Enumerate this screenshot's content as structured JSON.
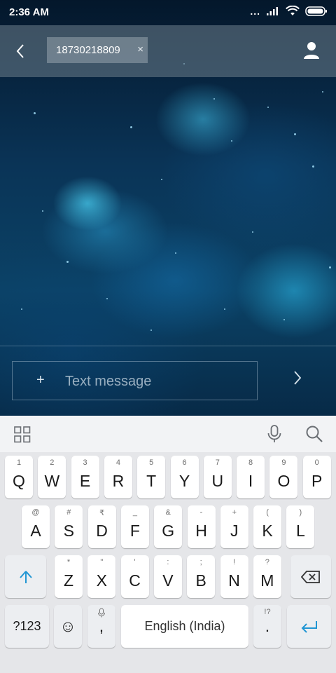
{
  "status_bar": {
    "time": "2:36 AM",
    "dots": "...",
    "icons": [
      "signal-icon",
      "wifi-icon",
      "battery-icon"
    ]
  },
  "header": {
    "recipient": "18730218809",
    "remove_symbol": "×"
  },
  "compose": {
    "add_symbol": "+",
    "placeholder": "Text message"
  },
  "keyboard": {
    "row1": [
      {
        "key": "Q",
        "hint": "1"
      },
      {
        "key": "W",
        "hint": "2"
      },
      {
        "key": "E",
        "hint": "3"
      },
      {
        "key": "R",
        "hint": "4"
      },
      {
        "key": "T",
        "hint": "5"
      },
      {
        "key": "Y",
        "hint": "6"
      },
      {
        "key": "U",
        "hint": "7"
      },
      {
        "key": "I",
        "hint": "8"
      },
      {
        "key": "O",
        "hint": "9"
      },
      {
        "key": "P",
        "hint": "0"
      }
    ],
    "row2": [
      {
        "key": "A",
        "hint": "@"
      },
      {
        "key": "S",
        "hint": "#"
      },
      {
        "key": "D",
        "hint": "₹"
      },
      {
        "key": "F",
        "hint": "_"
      },
      {
        "key": "G",
        "hint": "&"
      },
      {
        "key": "H",
        "hint": "-"
      },
      {
        "key": "J",
        "hint": "+"
      },
      {
        "key": "K",
        "hint": "("
      },
      {
        "key": "L",
        "hint": ")"
      }
    ],
    "row3": [
      {
        "key": "Z",
        "hint": "*"
      },
      {
        "key": "X",
        "hint": "\""
      },
      {
        "key": "C",
        "hint": "'"
      },
      {
        "key": "V",
        "hint": ":"
      },
      {
        "key": "B",
        "hint": ";"
      },
      {
        "key": "N",
        "hint": "!"
      },
      {
        "key": "M",
        "hint": "?"
      }
    ],
    "symbols_label": "?123",
    "emoji_symbol": "☺",
    "comma": ",",
    "space_label": "English (India)",
    "period": ".",
    "period_hint": "!?"
  },
  "colors": {
    "accent": "#2196d3",
    "keyboard_bg": "#e5e6e9",
    "key_bg": "#ffffff"
  }
}
